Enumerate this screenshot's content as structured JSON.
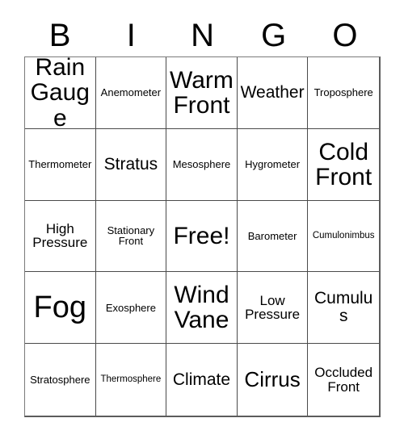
{
  "card": {
    "header_letters": [
      "B",
      "I",
      "N",
      "G",
      "O"
    ],
    "colors": {
      "background": "#ffffff",
      "text": "#000000",
      "grid_line": "#4a4a4a",
      "outer_border": "#5c5c5c"
    },
    "grid": {
      "columns": 5,
      "rows": 5,
      "free_space_label": "Free!",
      "cells": [
        {
          "label": "Rain Gauge",
          "size": "xl"
        },
        {
          "label": "Anemometer",
          "size": "xs"
        },
        {
          "label": "Warm Front",
          "size": "xl"
        },
        {
          "label": "Weather",
          "size": "md"
        },
        {
          "label": "Troposphere",
          "size": "xs"
        },
        {
          "label": "Thermometer",
          "size": "xs"
        },
        {
          "label": "Stratus",
          "size": "md"
        },
        {
          "label": "Mesosphere",
          "size": "xs"
        },
        {
          "label": "Hygrometer",
          "size": "xs"
        },
        {
          "label": "Cold Front",
          "size": "xl"
        },
        {
          "label": "High Pressure",
          "size": "sm"
        },
        {
          "label": "Stationary Front",
          "size": "xs"
        },
        {
          "label": "Free!",
          "size": "xl"
        },
        {
          "label": "Barometer",
          "size": "xs"
        },
        {
          "label": "Cumulonimbus",
          "size": "xxs"
        },
        {
          "label": "Fog",
          "size": "xxl"
        },
        {
          "label": "Exosphere",
          "size": "xs"
        },
        {
          "label": "Wind Vane",
          "size": "xl"
        },
        {
          "label": "Low Pressure",
          "size": "sm"
        },
        {
          "label": "Cumulus",
          "size": "md"
        },
        {
          "label": "Stratosphere",
          "size": "xs"
        },
        {
          "label": "Thermosphere",
          "size": "xxs"
        },
        {
          "label": "Climate",
          "size": "md"
        },
        {
          "label": "Cirrus",
          "size": "lg"
        },
        {
          "label": "Occluded Front",
          "size": "sm"
        }
      ]
    }
  }
}
